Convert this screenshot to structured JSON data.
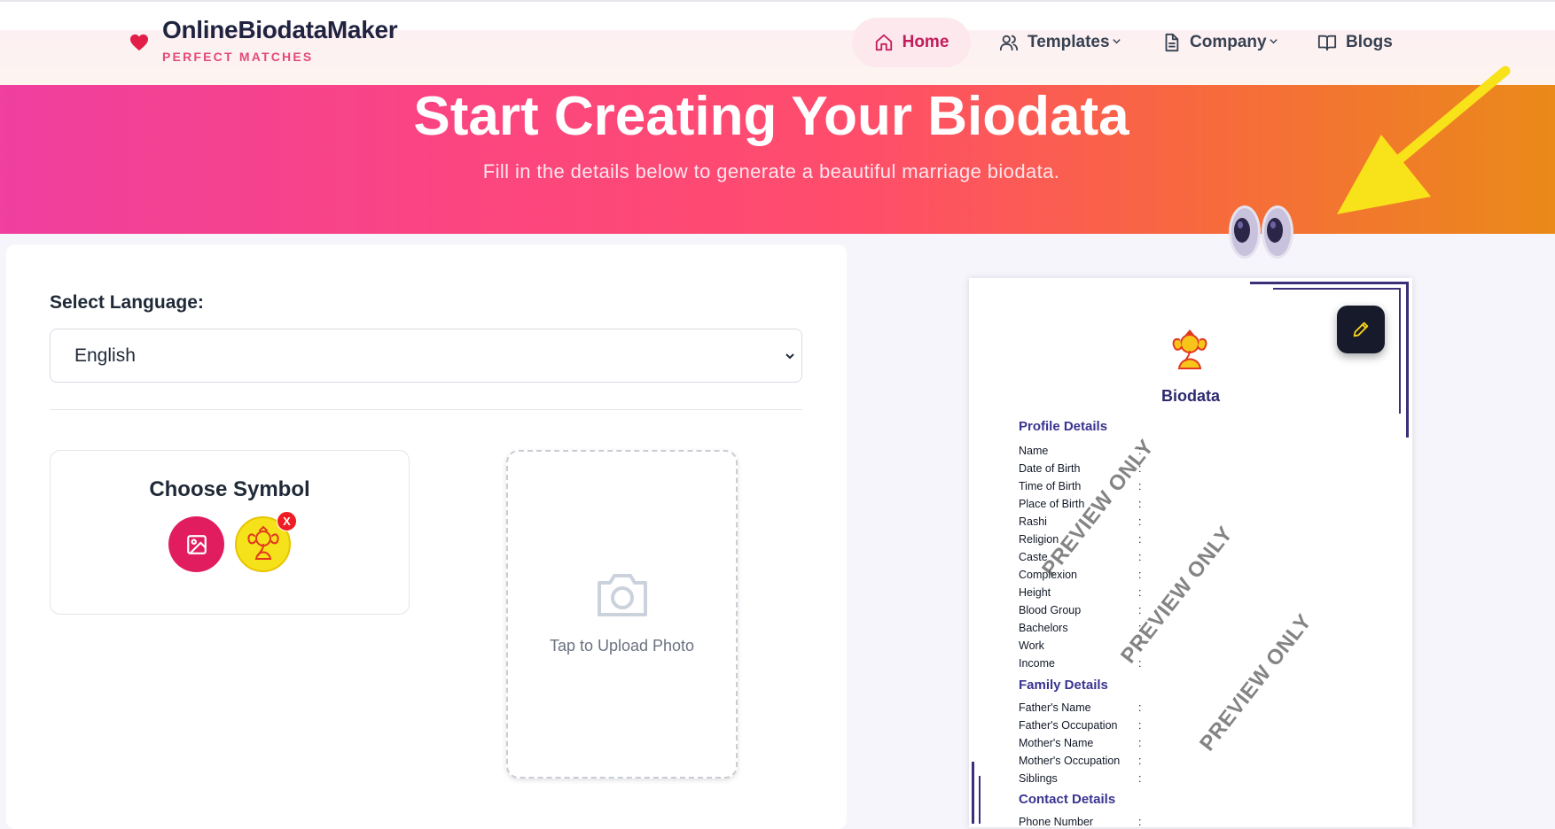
{
  "brand": {
    "title": "OnlineBiodataMaker",
    "subtitle": "PERFECT MATCHES",
    "accent": "#e11d48"
  },
  "nav": [
    {
      "label": "Home",
      "icon": "home-icon",
      "active": true
    },
    {
      "label": "Templates",
      "icon": "users-icon",
      "has_dropdown": true
    },
    {
      "label": "Company",
      "icon": "document-icon",
      "has_dropdown": true
    },
    {
      "label": "Blogs",
      "icon": "book-icon"
    }
  ],
  "hero": {
    "title": "Start Creating Your Biodata",
    "subtitle": "Fill in the details below to generate a beautiful marriage biodata."
  },
  "form": {
    "language_label": "Select Language:",
    "language_value": "English",
    "symbol_title": "Choose Symbol",
    "symbol_remove": "X",
    "photo_label": "Tap to Upload Photo"
  },
  "preview": {
    "title": "Biodata",
    "watermark": "PREVIEW ONLY",
    "sections": [
      {
        "title": "Profile Details",
        "fields": [
          "Name",
          "Date of Birth",
          "Time of Birth",
          "Place of Birth",
          "Rashi",
          "Religion",
          "Caste",
          "Complexion",
          "Height",
          "Blood Group",
          "Bachelors",
          "Work",
          "Income"
        ]
      },
      {
        "title": "Family Details",
        "fields": [
          "Father's Name",
          "Father's Occupation",
          "Mother's Name",
          "Mother's Occupation",
          "Siblings"
        ]
      },
      {
        "title": "Contact Details",
        "fields": [
          "Phone Number"
        ]
      }
    ],
    "colon": ":"
  },
  "colors": {
    "hero_start": "#ef3f9f",
    "hero_end": "#ea8a19",
    "frame": "#3b2f7a",
    "section_title": "#3a3490"
  }
}
